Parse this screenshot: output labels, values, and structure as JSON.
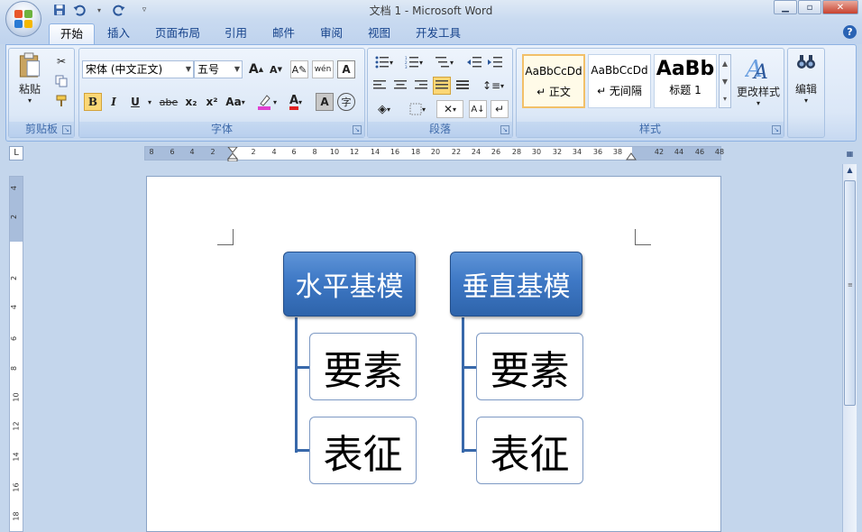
{
  "window": {
    "title": "文档 1 - Microsoft Word",
    "minimize_icon": "minimize-icon",
    "maximize_icon": "maximize-icon",
    "close_icon": "close-icon"
  },
  "qat": [
    "save-icon",
    "undo-icon",
    "redo-icon",
    "customize-icon"
  ],
  "tabs": [
    {
      "label": "开始",
      "active": true
    },
    {
      "label": "插入"
    },
    {
      "label": "页面布局"
    },
    {
      "label": "引用"
    },
    {
      "label": "邮件"
    },
    {
      "label": "审阅"
    },
    {
      "label": "视图"
    },
    {
      "label": "开发工具"
    }
  ],
  "ribbon": {
    "clipboard": {
      "label": "剪贴板",
      "paste": "粘贴"
    },
    "font": {
      "label": "字体",
      "font_name": "宋体 (中文正文)",
      "font_size": "五号",
      "bold": "B",
      "italic": "I",
      "underline": "U",
      "strike": "abe",
      "subscript": "x₂",
      "superscript": "x²",
      "change_case": "Aa",
      "grow": "A",
      "shrink": "A",
      "wen": "wén",
      "clear": "A",
      "char_border": "A",
      "enclose": "字"
    },
    "paragraph": {
      "label": "段落"
    },
    "styles": {
      "label": "样式",
      "items": [
        {
          "sample": "AaBbCcDd",
          "name": "↵ 正文"
        },
        {
          "sample": "AaBbCcDd",
          "name": "↵ 无间隔"
        },
        {
          "sample": "AaBb",
          "name": "标题 1"
        }
      ],
      "change_styles": "更改样式"
    },
    "editing": {
      "label": "编辑"
    }
  },
  "ruler": {
    "numbers": [
      "8",
      "6",
      "4",
      "2",
      "2",
      "4",
      "6",
      "8",
      "10",
      "12",
      "14",
      "16",
      "18",
      "20",
      "22",
      "24",
      "26",
      "28",
      "30",
      "32",
      "34",
      "36",
      "38",
      "42",
      "44",
      "46",
      "48"
    ]
  },
  "vruler": {
    "numbers": [
      "4",
      "2",
      "2",
      "4",
      "6",
      "8",
      "10",
      "12",
      "14",
      "16",
      "18"
    ]
  },
  "diagram": {
    "left": {
      "header": "水平基模",
      "items": [
        "要素",
        "表征"
      ]
    },
    "right": {
      "header": "垂直基模",
      "items": [
        "要素",
        "表征"
      ]
    }
  },
  "colors": {
    "header_fill": "#3e78c5",
    "connector": "#3868aa",
    "ribbon_bg": "#dbe7f7"
  }
}
